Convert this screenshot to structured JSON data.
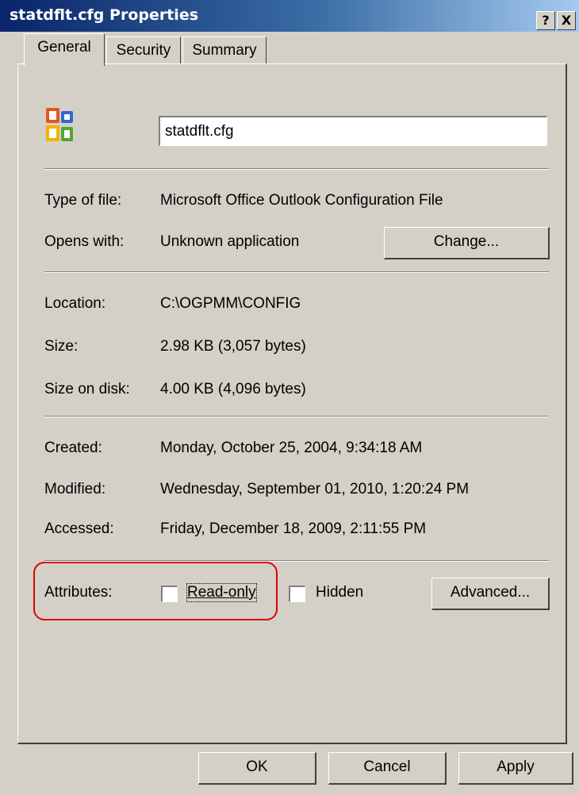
{
  "window": {
    "title": "statdflt.cfg Properties",
    "help_label": "?",
    "close_label": "X"
  },
  "tabs": [
    {
      "label": "General"
    },
    {
      "label": "Security"
    },
    {
      "label": "Summary"
    }
  ],
  "file": {
    "icon": "office-icon",
    "name_value": "statdflt.cfg"
  },
  "info": {
    "type_label": "Type of file:",
    "type_value": "Microsoft Office Outlook Configuration File",
    "opens_label": "Opens with:",
    "opens_value": "Unknown application",
    "change_button": "Change...",
    "location_label": "Location:",
    "location_value": "C:\\OGPMM\\CONFIG",
    "size_label": "Size:",
    "size_value": "2.98 KB (3,057 bytes)",
    "size_disk_label": "Size on disk:",
    "size_disk_value": "4.00 KB (4,096 bytes)",
    "created_label": "Created:",
    "created_value": "Monday, October 25, 2004, 9:34:18 AM",
    "modified_label": "Modified:",
    "modified_value": "Wednesday, September 01, 2010, 1:20:24 PM",
    "accessed_label": "Accessed:",
    "accessed_value": "Friday, December 18, 2009, 2:11:55 PM"
  },
  "attributes": {
    "label": "Attributes:",
    "readonly_label": "Read-only",
    "readonly_checked": false,
    "hidden_label": "Hidden",
    "hidden_checked": false,
    "advanced_button": "Advanced..."
  },
  "footer": {
    "ok": "OK",
    "cancel": "Cancel",
    "apply": "Apply"
  },
  "colors": {
    "titlebar_start": "#0a246a",
    "face": "#d4d0c8",
    "highlight_circle": "#e00000"
  }
}
